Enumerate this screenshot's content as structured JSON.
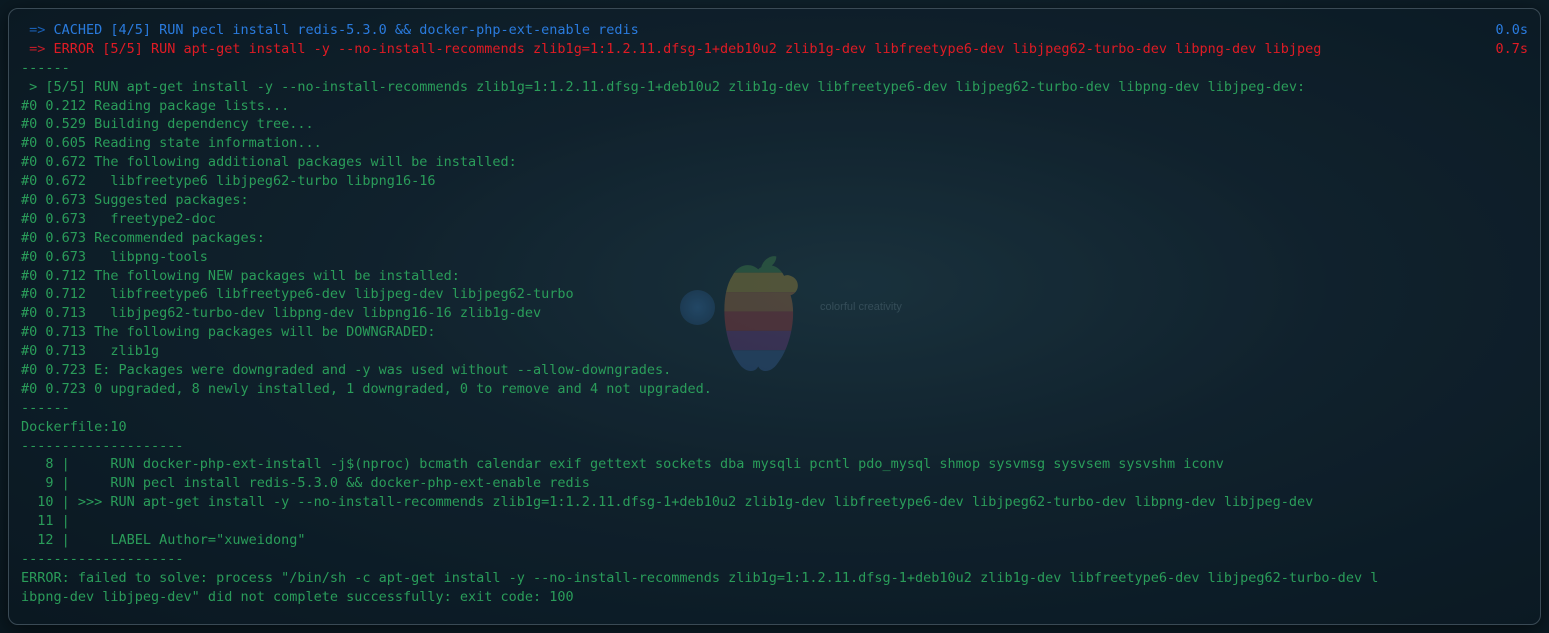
{
  "wallpaper": {
    "tag": "colorful creativity"
  },
  "header": {
    "cached": {
      "arrow": " => ",
      "text": "CACHED [4/5] RUN pecl install redis-5.3.0 && docker-php-ext-enable redis",
      "time": "0.0s"
    },
    "error": {
      "arrow": " => ",
      "text": "ERROR [5/5] RUN apt-get install -y --no-install-recommends zlib1g=1:1.2.11.dfsg-1+deb10u2 zlib1g-dev libfreetype6-dev libjpeg62-turbo-dev libpng-dev libjpeg",
      "time": "0.7s"
    }
  },
  "output": [
    "------",
    " > [5/5] RUN apt-get install -y --no-install-recommends zlib1g=1:1.2.11.dfsg-1+deb10u2 zlib1g-dev libfreetype6-dev libjpeg62-turbo-dev libpng-dev libjpeg-dev:",
    "#0 0.212 Reading package lists...",
    "#0 0.529 Building dependency tree...",
    "#0 0.605 Reading state information...",
    "#0 0.672 The following additional packages will be installed:",
    "#0 0.672   libfreetype6 libjpeg62-turbo libpng16-16",
    "#0 0.673 Suggested packages:",
    "#0 0.673   freetype2-doc",
    "#0 0.673 Recommended packages:",
    "#0 0.673   libpng-tools",
    "#0 0.712 The following NEW packages will be installed:",
    "#0 0.712   libfreetype6 libfreetype6-dev libjpeg-dev libjpeg62-turbo",
    "#0 0.713   libjpeg62-turbo-dev libpng-dev libpng16-16 zlib1g-dev",
    "#0 0.713 The following packages will be DOWNGRADED:",
    "#0 0.713   zlib1g",
    "#0 0.723 E: Packages were downgraded and -y was used without --allow-downgrades.",
    "#0 0.723 0 upgraded, 8 newly installed, 1 downgraded, 0 to remove and 4 not upgraded.",
    "------",
    "Dockerfile:10",
    "--------------------",
    "   8 |     RUN docker-php-ext-install -j$(nproc) bcmath calendar exif gettext sockets dba mysqli pcntl pdo_mysql shmop sysvmsg sysvsem sysvshm iconv",
    "   9 |     RUN pecl install redis-5.3.0 && docker-php-ext-enable redis",
    "  10 | >>> RUN apt-get install -y --no-install-recommends zlib1g=1:1.2.11.dfsg-1+deb10u2 zlib1g-dev libfreetype6-dev libjpeg62-turbo-dev libpng-dev libjpeg-dev",
    "  11 |     ",
    "  12 |     LABEL Author=\"xuweidong\"",
    "--------------------",
    "ERROR: failed to solve: process \"/bin/sh -c apt-get install -y --no-install-recommends zlib1g=1:1.2.11.dfsg-1+deb10u2 zlib1g-dev libfreetype6-dev libjpeg62-turbo-dev l",
    "ibpng-dev libjpeg-dev\" did not complete successfully: exit code: 100"
  ]
}
